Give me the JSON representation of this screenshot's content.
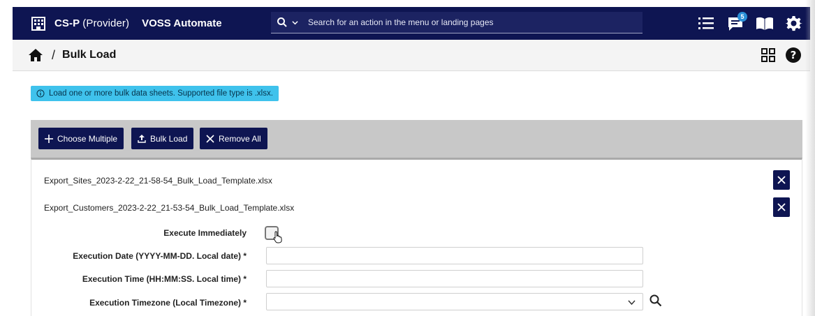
{
  "topbar": {
    "tenant_bold": "CS-P",
    "tenant_light": "(Provider)",
    "app_name": "VOSS Automate",
    "search_placeholder": "Search for an action in the menu or landing pages",
    "notifications_count": "5",
    "icons": [
      "building-icon",
      "search-icon",
      "chevron-down-icon",
      "list-icon",
      "chat-icon",
      "book-icon",
      "gear-icon"
    ]
  },
  "breadcrumb": {
    "separator": "/",
    "title": "Bulk Load",
    "icons": [
      "home-icon",
      "grid-icon",
      "help-icon"
    ]
  },
  "info": {
    "message": "Load one or more bulk data sheets. Supported file type is .xlsx."
  },
  "toolbar": {
    "choose_multiple": "Choose Multiple",
    "bulk_load": "Bulk Load",
    "remove_all": "Remove All"
  },
  "files": [
    "Export_Sites_2023-2-22_21-58-54_Bulk_Load_Template.xlsx",
    "Export_Customers_2023-2-22_21-53-54_Bulk_Load_Template.xlsx"
  ],
  "form": {
    "execute_immediately": "Execute Immediately",
    "execution_date": "Execution Date (YYYY-MM-DD. Local date) *",
    "execution_time": "Execution Time (HH:MM:SS. Local time) *",
    "execution_timezone": "Execution Timezone (Local Timezone) *",
    "execution_date_value": "",
    "execution_time_value": "",
    "execution_timezone_value": ""
  },
  "colors": {
    "navy": "#0e1552",
    "info_banner": "#3fc2ec",
    "toolbar_panel": "#c8c8c8"
  }
}
